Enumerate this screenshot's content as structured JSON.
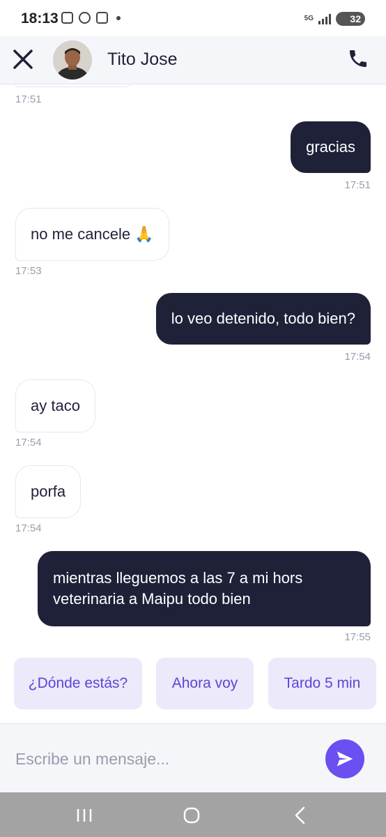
{
  "status_bar": {
    "time": "18:13",
    "network": "5G",
    "battery": "32"
  },
  "header": {
    "contact_name": "Tito Jose"
  },
  "messages": [
    {
      "direction": "out",
      "text": "gracias",
      "time": "17:51"
    },
    {
      "direction": "in",
      "text": "no me cancele 🙏",
      "time": "17:53"
    },
    {
      "direction": "out",
      "text": "lo veo detenido, todo bien?",
      "time": "17:54"
    },
    {
      "direction": "in",
      "text": "ay taco",
      "time": "17:54"
    },
    {
      "direction": "in",
      "text": "porfa",
      "time": "17:54"
    },
    {
      "direction": "out",
      "text": "mientras lleguemos a las 7 a mi hors veterinaria a Maipu  todo bien",
      "time": "17:55"
    }
  ],
  "top_partial_time": "17:51",
  "quick_replies": [
    "¿Dónde estás?",
    "Ahora voy",
    "Tardo 5 min"
  ],
  "composer": {
    "placeholder": "Escribe un mensaje..."
  },
  "colors": {
    "accent": "#6b4ff0",
    "outgoing_bubble": "#1f2139",
    "quick_reply_bg": "#ebe9fa",
    "quick_reply_text": "#5b46d6"
  }
}
